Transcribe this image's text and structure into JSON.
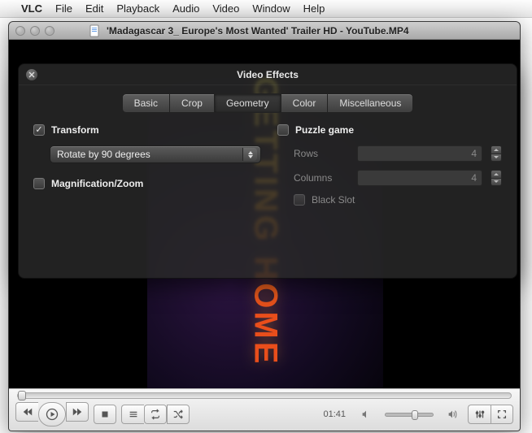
{
  "menubar": {
    "app": "VLC",
    "items": [
      "File",
      "Edit",
      "Playback",
      "Audio",
      "Video",
      "Window",
      "Help"
    ]
  },
  "window": {
    "title": "'Madagascar 3_ Europe's Most Wanted' Trailer HD - YouTube.MP4"
  },
  "video": {
    "overlay_text": "GETTING HOME"
  },
  "controls": {
    "time": "01:41"
  },
  "panel": {
    "title": "Video Effects",
    "tabs": [
      "Basic",
      "Crop",
      "Geometry",
      "Color",
      "Miscellaneous"
    ],
    "active_tab": "Geometry",
    "transform": {
      "label": "Transform",
      "checked": true,
      "select_value": "Rotate by 90 degrees"
    },
    "magnification": {
      "label": "Magnification/Zoom",
      "checked": false
    },
    "puzzle": {
      "label": "Puzzle game",
      "checked": false,
      "rows_label": "Rows",
      "rows_value": "4",
      "cols_label": "Columns",
      "cols_value": "4",
      "black_slot_label": "Black Slot",
      "black_slot_checked": false
    }
  }
}
